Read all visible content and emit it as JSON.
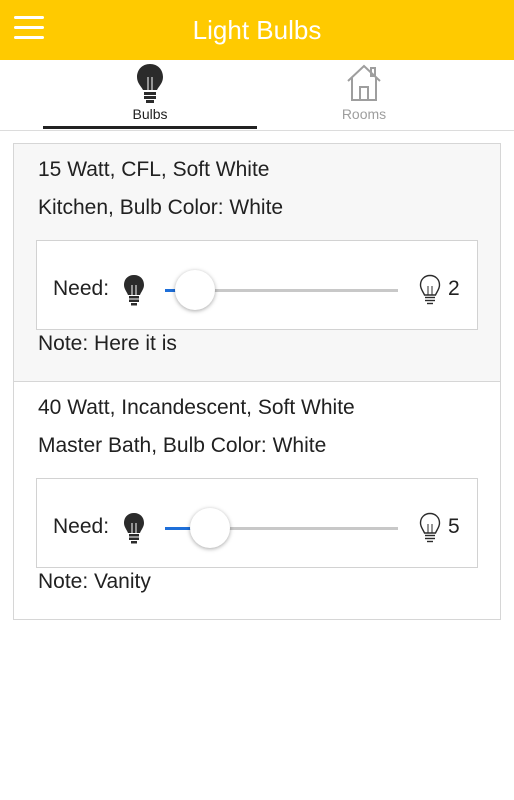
{
  "appbar": {
    "title": "Light Bulbs"
  },
  "tabs": [
    {
      "label": "Bulbs",
      "icon": "bulb-icon",
      "active": true
    },
    {
      "label": "Rooms",
      "icon": "house-icon",
      "active": false
    }
  ],
  "colors": {
    "appbar": "#ffca00",
    "slider_active": "#1e6fd9"
  },
  "bulbs": [
    {
      "description": "15 Watt, CFL, Soft White",
      "location": "Kitchen, Bulb Color: White",
      "need_label": "Need:",
      "need_count": "2",
      "note": "Note: Here it is"
    },
    {
      "description": "40 Watt, Incandescent, Soft White",
      "location": "Master Bath, Bulb Color: White",
      "need_label": "Need:",
      "need_count": "5",
      "note": "Note: Vanity"
    }
  ]
}
